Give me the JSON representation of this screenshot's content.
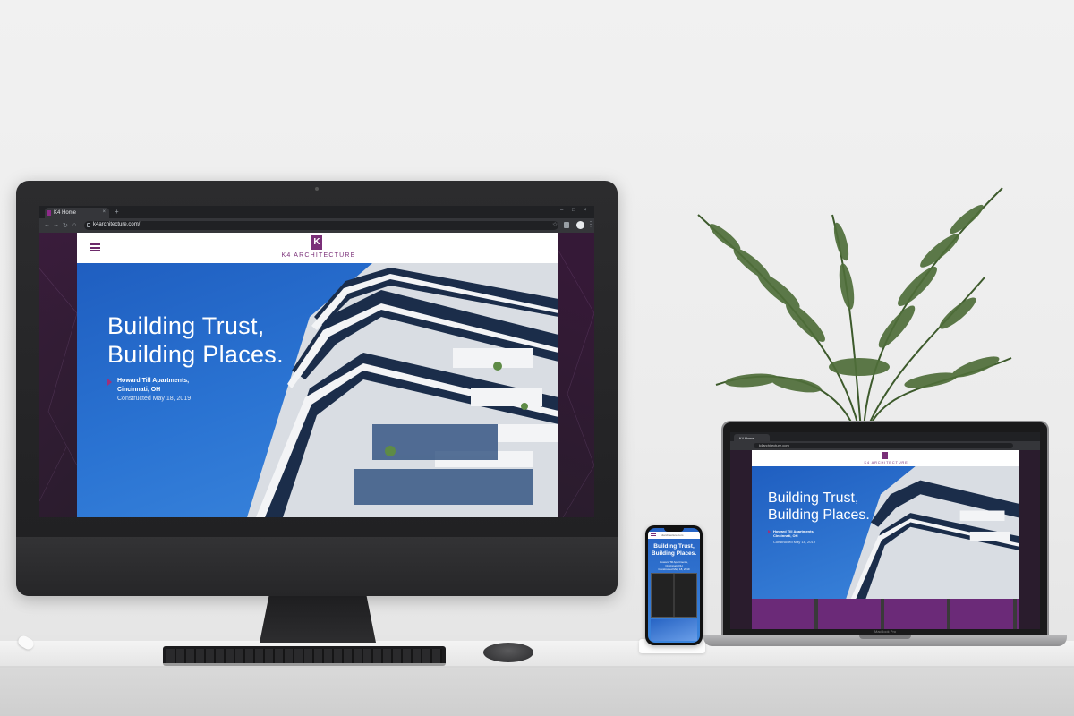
{
  "imac": {
    "tab_title": "K4 Home",
    "tab_close": "×",
    "new_tab": "+",
    "url": "k4architecture.com/",
    "nav": {
      "back": "←",
      "forward": "→",
      "reload": "↻",
      "home": "⌂"
    },
    "window": {
      "minimize": "–",
      "maximize": "□",
      "close": "×"
    },
    "star": "☆",
    "menu": "⋮"
  },
  "site": {
    "logo_mark": "K",
    "logo_text": "K4 ARCHITECTURE",
    "hero_title_line1": "Building Trust,",
    "hero_title_line2": "Building Places.",
    "project_line1": "Howard Till Apartments,",
    "project_line2": "Cincinnati, OH",
    "constructed": "Constructed May 18, 2019"
  },
  "phone": {
    "url": "k4architecture.com",
    "title_line1": "Building Trust,",
    "title_line2": "Building Places.",
    "project_line1": "Howard Till Apartments,",
    "project_line2": "Cincinnati, OH",
    "constructed": "Constructed May 18, 2019"
  },
  "macbook": {
    "tab_title": "K4 Home",
    "url": "k4architecture.com",
    "label": "MacBook Pro"
  },
  "colors": {
    "brand_purple": "#7a2f78",
    "sky_blue": "#2a73d2",
    "page_bg": "#2a1c2d"
  },
  "icons": {
    "apple_logo": "",
    "menu": "hamburger-icon"
  }
}
